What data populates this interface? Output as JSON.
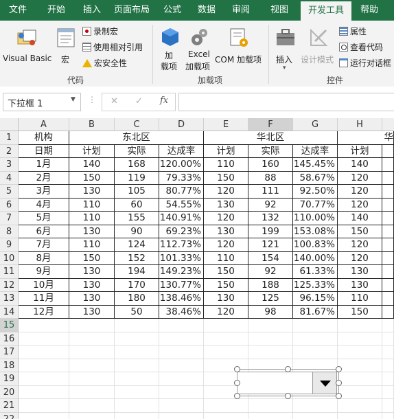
{
  "ribbon_tabs": [
    "文件",
    "开始",
    "插入",
    "页面布局",
    "公式",
    "数据",
    "审阅",
    "视图",
    "开发工具",
    "帮助"
  ],
  "active_tab": "开发工具",
  "ribbon": {
    "code_group": {
      "label": "代码",
      "visual_basic": "Visual Basic",
      "macro": "宏",
      "record_macro": "录制宏",
      "relative_ref": "使用相对引用",
      "macro_security": "宏安全性"
    },
    "addins_group": {
      "label": "加载项",
      "addins_line1": "加",
      "addins_line2": "载项",
      "excel_line1": "Excel",
      "excel_line2": "加载项",
      "com_addins": "COM 加载项"
    },
    "controls_group": {
      "label": "控件",
      "insert": "插入",
      "design_mode": "设计模式",
      "properties": "属性",
      "view_code": "查看代码",
      "run_dialog": "运行对话框"
    }
  },
  "formula_bar": {
    "name_box": "下拉框 1",
    "fx": "fx",
    "cancel": "✕",
    "enter": "✓",
    "content": ""
  },
  "columns": [
    "A",
    "B",
    "C",
    "D",
    "E",
    "F",
    "G",
    "H"
  ],
  "selected_column": "F",
  "selected_row": "15",
  "rows": [
    "1",
    "2",
    "3",
    "4",
    "5",
    "6",
    "7",
    "8",
    "9",
    "10",
    "11",
    "12",
    "13",
    "14",
    "15",
    "16",
    "17",
    "18",
    "19",
    "20",
    "21",
    "22"
  ],
  "table": {
    "region_header": "机构",
    "regions": [
      "东北区",
      "华北区",
      "华"
    ],
    "date_header": "日期",
    "sub_headers": [
      "计划",
      "实际",
      "达成率",
      "计划",
      "实际",
      "达成率",
      "计划"
    ],
    "data": [
      [
        "1月",
        "140",
        "168",
        "120.00%",
        "110",
        "160",
        "145.45%",
        "140"
      ],
      [
        "2月",
        "150",
        "119",
        "79.33%",
        "150",
        "88",
        "58.67%",
        "120"
      ],
      [
        "3月",
        "130",
        "105",
        "80.77%",
        "120",
        "111",
        "92.50%",
        "120"
      ],
      [
        "4月",
        "110",
        "60",
        "54.55%",
        "130",
        "92",
        "70.77%",
        "120"
      ],
      [
        "5月",
        "110",
        "155",
        "140.91%",
        "120",
        "132",
        "110.00%",
        "140"
      ],
      [
        "6月",
        "130",
        "90",
        "69.23%",
        "130",
        "199",
        "153.08%",
        "150"
      ],
      [
        "7月",
        "110",
        "124",
        "112.73%",
        "120",
        "121",
        "100.83%",
        "120"
      ],
      [
        "8月",
        "150",
        "152",
        "101.33%",
        "110",
        "154",
        "140.00%",
        "120"
      ],
      [
        "9月",
        "130",
        "194",
        "149.23%",
        "150",
        "92",
        "61.33%",
        "130"
      ],
      [
        "10月",
        "130",
        "170",
        "130.77%",
        "150",
        "188",
        "125.33%",
        "130"
      ],
      [
        "11月",
        "130",
        "180",
        "138.46%",
        "130",
        "125",
        "96.15%",
        "110"
      ],
      [
        "12月",
        "130",
        "50",
        "38.46%",
        "120",
        "98",
        "81.67%",
        "150"
      ]
    ]
  },
  "colors": {
    "ribbon": "#217346",
    "ribbon_body": "#f3f3f3",
    "accent_text": "#217346"
  }
}
